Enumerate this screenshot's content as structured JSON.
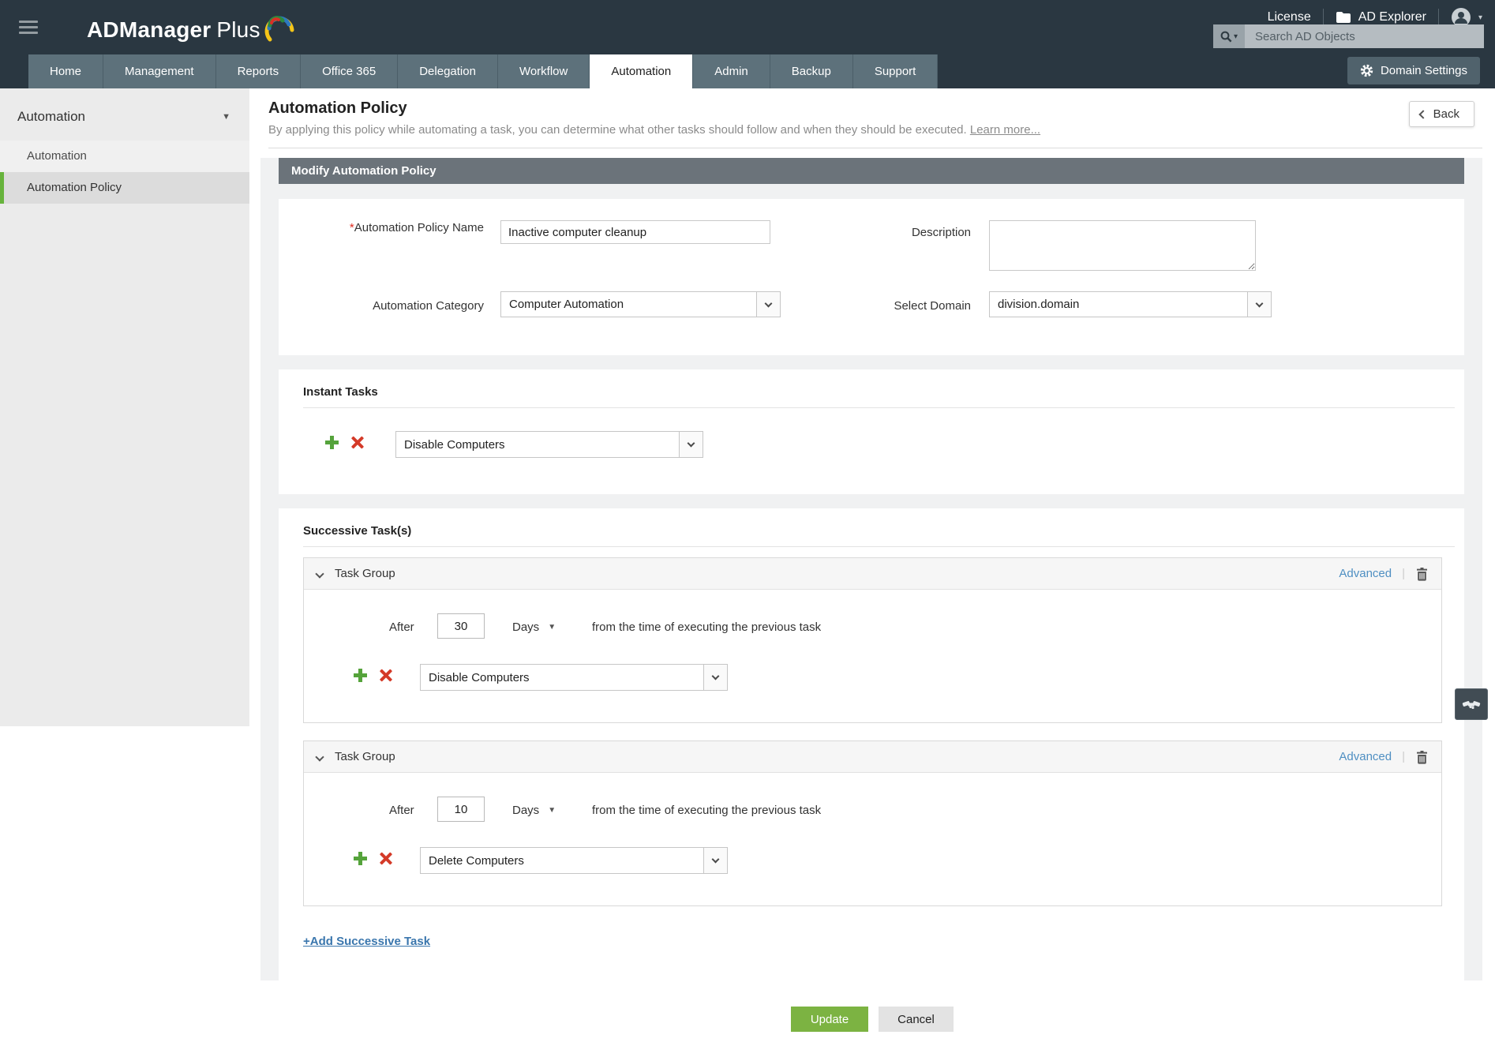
{
  "topbar": {
    "brand": {
      "name": "ADManager",
      "suffix": "Plus"
    },
    "links": {
      "license": "License",
      "ad_explorer": "AD Explorer"
    },
    "search": {
      "placeholder": "Search AD Objects"
    }
  },
  "nav": {
    "tabs": [
      {
        "label": "Home"
      },
      {
        "label": "Management"
      },
      {
        "label": "Reports"
      },
      {
        "label": "Office 365"
      },
      {
        "label": "Delegation"
      },
      {
        "label": "Workflow"
      },
      {
        "label": "Automation",
        "active": true
      },
      {
        "label": "Admin"
      },
      {
        "label": "Backup"
      },
      {
        "label": "Support"
      }
    ],
    "domain_settings": "Domain Settings"
  },
  "sidebar": {
    "header": "Automation",
    "items": [
      {
        "label": "Automation",
        "selected": false
      },
      {
        "label": "Automation Policy",
        "selected": true
      }
    ]
  },
  "page": {
    "title": "Automation Policy",
    "subtitle": "By applying this policy while automating a task, you can determine what other tasks should follow and when they should be executed.",
    "learn_more": "Learn more...",
    "back": "Back"
  },
  "form": {
    "header": "Modify Automation Policy",
    "fields": {
      "policy_name": {
        "required": "*",
        "label": "Automation Policy Name",
        "value": "Inactive computer cleanup"
      },
      "description": {
        "label": "Description",
        "value": ""
      },
      "category": {
        "label": "Automation Category",
        "value": "Computer Automation"
      },
      "domain": {
        "label": "Select Domain",
        "value": "division.domain"
      }
    }
  },
  "instant": {
    "heading": "Instant Tasks",
    "task_value": "Disable Computers"
  },
  "successive": {
    "heading": "Successive Task(s)",
    "groups": [
      {
        "title": "Task Group",
        "after_label": "After",
        "after": "30",
        "unit": "Days",
        "suffix": "from the time of executing the previous task",
        "task": "Disable Computers",
        "advanced": "Advanced",
        "sep": "|"
      },
      {
        "title": "Task Group",
        "after_label": "After",
        "after": "10",
        "unit": "Days",
        "suffix": "from the time of executing the previous task",
        "task": "Delete Computers",
        "advanced": "Advanced",
        "sep": "|"
      }
    ],
    "add_link": "+Add Successive Task"
  },
  "actions": {
    "update": "Update",
    "cancel": "Cancel"
  },
  "icons": {
    "hamburger": "css-bars",
    "search": "magnifier",
    "search_caret": "▾",
    "folder": "folder-shape",
    "user": "avatar-circle",
    "user_caret": "▾",
    "gear": "gear-circle",
    "sidebar_caret": "▼",
    "back_chevron": "css-chevron-left",
    "select_chevron": "css-chevron-down",
    "group_chevron": "css-chevron-down",
    "plus": "css-plus",
    "close": "css-x",
    "trash": "trash-can-svg",
    "days_caret": "▼",
    "handshake": "handshake-svg"
  },
  "colors": {
    "header_dark": "#2a3741",
    "tab_bg": "#5d717b",
    "tab_active": "#ffffff",
    "panel_gray": "#f0f1f2",
    "bar_gray": "#6b737a",
    "sidebar_bg": "#ebebeb",
    "selected_green": "#67b33c",
    "plus_green": "#55a33b",
    "x_red": "#d43a28",
    "link_blue": "#4f8fc2",
    "update_green": "#7cb342",
    "required_red": "#e02b20"
  }
}
